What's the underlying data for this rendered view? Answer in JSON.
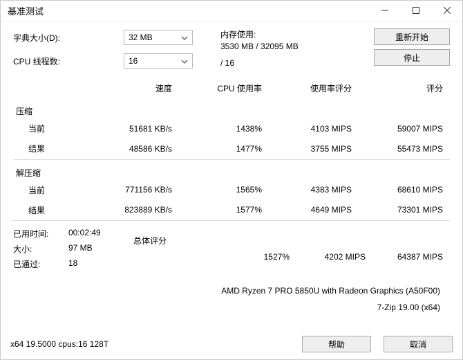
{
  "window": {
    "title": "基准测试"
  },
  "controls": {
    "dict_label": "字典大小(D):",
    "dict_value": "32 MB",
    "threads_label": "CPU 线程数:",
    "threads_value": "16",
    "threads_total": "/ 16",
    "mem_label": "内存使用:",
    "mem_value": "3530 MB / 32095 MB",
    "restart": "重新开始",
    "stop": "停止"
  },
  "headers": {
    "speed": "速度",
    "cpu_usage": "CPU 使用率",
    "usage_rating": "使用率评分",
    "rating": "评分"
  },
  "sections": {
    "compress": "压缩",
    "decompress": "解压缩",
    "current": "当前",
    "result": "结果"
  },
  "compress": {
    "current": {
      "speed": "51681 KB/s",
      "cpu": "1438%",
      "urating": "4103 MIPS",
      "rating": "59007 MIPS"
    },
    "result": {
      "speed": "48586 KB/s",
      "cpu": "1477%",
      "urating": "3755 MIPS",
      "rating": "55473 MIPS"
    }
  },
  "decompress": {
    "current": {
      "speed": "771156 KB/s",
      "cpu": "1565%",
      "urating": "4383 MIPS",
      "rating": "68610 MIPS"
    },
    "result": {
      "speed": "823889 KB/s",
      "cpu": "1577%",
      "urating": "4649 MIPS",
      "rating": "73301 MIPS"
    }
  },
  "bottom": {
    "elapsed_label": "已用时间:",
    "elapsed_value": "00:02:49",
    "size_label": "大小:",
    "size_value": "97 MB",
    "passes_label": "已通过:",
    "passes_value": "18",
    "overall_label": "总体评分",
    "overall": {
      "cpu": "1527%",
      "urating": "4202 MIPS",
      "rating": "64387 MIPS"
    }
  },
  "sysinfo": {
    "cpu": "AMD Ryzen 7 PRO 5850U with Radeon Graphics     (A50F00)",
    "app": "7-Zip 19.00 (x64)"
  },
  "footer": {
    "version": "x64 19.5000 cpus:16 128T",
    "help": "帮助",
    "cancel": "取消"
  }
}
